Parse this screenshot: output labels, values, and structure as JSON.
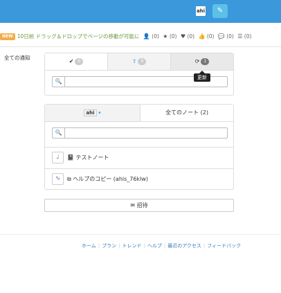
{
  "header": {
    "user_badge": "ahi",
    "edit_icon": "pencil-icon",
    "edit_glyph": "✎"
  },
  "notice": {
    "badge": "NEW",
    "text": "10日前 ドラッグ＆ドロップでページの移動が可能に",
    "stats": [
      {
        "icon": "user-icon",
        "glyph": "👤",
        "value": "(0)"
      },
      {
        "icon": "star-icon",
        "glyph": "★",
        "value": "(0)"
      },
      {
        "icon": "heart-icon",
        "glyph": "♥",
        "value": "(0)"
      },
      {
        "icon": "thumbs-up-icon",
        "glyph": "👍",
        "value": "(0)"
      },
      {
        "icon": "comments-icon",
        "glyph": "💬",
        "value": "(0)"
      },
      {
        "icon": "list-icon",
        "glyph": "☰",
        "value": "(0)"
      }
    ]
  },
  "sidebar": {
    "label": "全ての通知"
  },
  "notifications": {
    "tabs": [
      {
        "icon": "check-icon",
        "glyph": "✔",
        "count": "0"
      },
      {
        "icon": "upload-icon",
        "glyph": "⇪",
        "count": "0"
      },
      {
        "icon": "refresh-icon",
        "glyph": "⟳",
        "count": "1"
      }
    ],
    "search_placeholder": "",
    "tooltip": "更新"
  },
  "notes": {
    "user_tab": "ahi",
    "all_tab": "全てのノート (2)",
    "search_placeholder": "",
    "items": [
      {
        "icon": "book-icon",
        "glyph": "📓",
        "title": "テストノート"
      },
      {
        "icon": "copy-icon",
        "glyph": "⧉",
        "title": "ヘルプのコピー (ahis_76klw)"
      }
    ]
  },
  "invite": {
    "glyph": "✉",
    "label": "招待"
  },
  "footer": {
    "links": [
      "ホーム",
      "プラン",
      "トレンド",
      "ヘルプ",
      "最近のアクセス",
      "フィードバック"
    ]
  }
}
